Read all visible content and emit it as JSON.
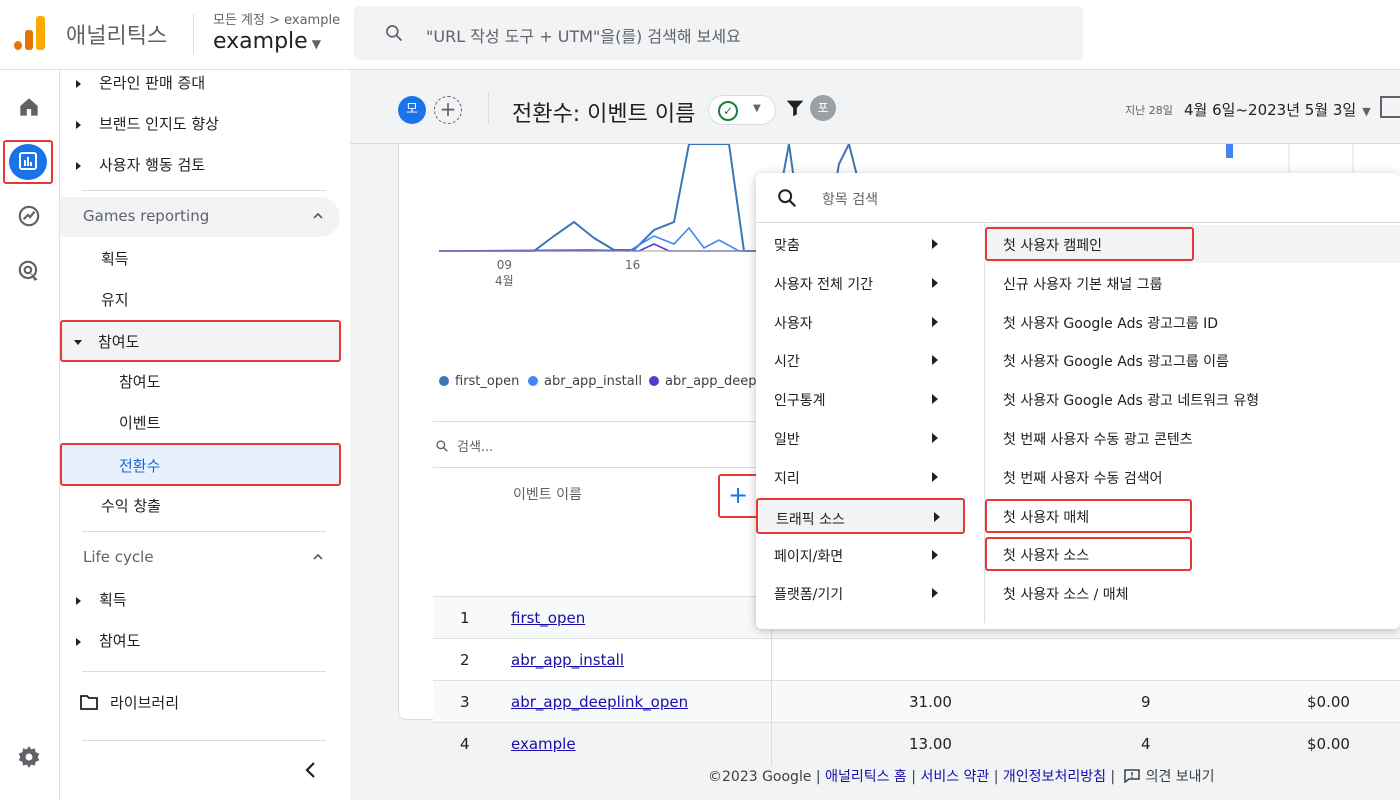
{
  "topbar": {
    "brand": "애널리틱스",
    "account_crumb": "모든 계정 > example",
    "account_name": "example",
    "search_placeholder": "\"URL 작성 도구 + UTM\"을(를) 검색해 보세요"
  },
  "nav": {
    "top_items": [
      "온라인 판매 증대",
      "브랜드 인지도 향상",
      "사용자 행동 검토"
    ],
    "games_reporting": {
      "title": "Games reporting",
      "items": [
        "획득",
        "유지",
        "참여도",
        "수익 창출"
      ],
      "engagement_children": [
        "참여도",
        "이벤트",
        "전환수"
      ]
    },
    "life_cycle": {
      "title": "Life cycle",
      "items": [
        "획득",
        "참여도"
      ]
    },
    "library": "라이브러리"
  },
  "header": {
    "avatar_mo": "모",
    "avatar_po": "포",
    "title": "전환수: 이벤트 이름",
    "date_small": "지난 28일",
    "date_range": "4월 6일~2023년 5월 3일"
  },
  "chart": {
    "ticks": [
      {
        "day": "09",
        "month": "4월"
      },
      {
        "day": "16",
        "month": ""
      }
    ],
    "legend": [
      "first_open",
      "abr_app_install",
      "abr_app_deepli"
    ],
    "colors": {
      "first_open": "#3c76b5",
      "abr_app_install": "#4285f4",
      "abr_app_deeplink_open": "#4b3fd0"
    }
  },
  "table": {
    "search_placeholder": "검색...",
    "column_header": "이벤트 이름",
    "add_label": "+",
    "rows": [
      {
        "rank": "1",
        "name": "first_open",
        "v1": "",
        "v2": "",
        "v3": ""
      },
      {
        "rank": "2",
        "name": "abr_app_install",
        "v1": "",
        "v2": "",
        "v3": ""
      },
      {
        "rank": "3",
        "name": "abr_app_deeplink_open",
        "v1": "31.00",
        "v2": "9",
        "v3": "$0.00"
      },
      {
        "rank": "4",
        "name": "example",
        "v1": "13.00",
        "v2": "4",
        "v3": "$0.00"
      }
    ]
  },
  "footer": {
    "copyright": "©2023 Google",
    "links": [
      "애널리틱스 홈",
      "서비스 약관",
      "개인정보처리방침"
    ],
    "feedback": "의견 보내기"
  },
  "menu": {
    "search_placeholder": "항목 검색",
    "categories": [
      "맞춤",
      "사용자 전체 기간",
      "사용자",
      "시간",
      "인구통계",
      "일반",
      "지리",
      "트래픽 소스",
      "페이지/화면",
      "플랫폼/기기"
    ],
    "selected_category": "트래픽 소스",
    "options": [
      "첫 사용자 캠페인",
      "신규 사용자 기본 채널 그룹",
      "첫 사용자 Google Ads 광고그룹 ID",
      "첫 사용자 Google Ads 광고그룹 이름",
      "첫 사용자 Google Ads 광고 네트워크 유형",
      "첫 번째 사용자 수동 광고 콘텐츠",
      "첫 번째 사용자 수동 검색어",
      "첫 사용자 매체",
      "첫 사용자 소스",
      "첫 사용자 소스 / 매체"
    ]
  }
}
